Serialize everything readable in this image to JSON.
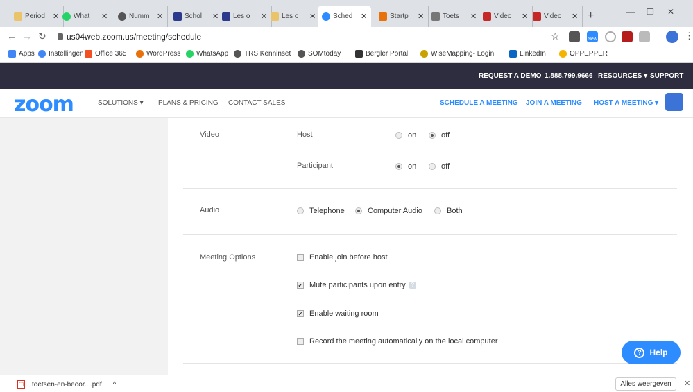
{
  "browser": {
    "tabs": [
      {
        "label": "Period",
        "color": "#e9c46a"
      },
      {
        "label": "What",
        "color": "#25d366"
      },
      {
        "label": "Numm",
        "color": "#555555"
      },
      {
        "label": "Schol",
        "color": "#2b3a8c"
      },
      {
        "label": "Les o",
        "color": "#2b3a8c"
      },
      {
        "label": "Les o",
        "color": "#e9c46a"
      },
      {
        "label": "Sched",
        "color": "#2d8cff"
      },
      {
        "label": "Startp",
        "color": "#e8710a"
      },
      {
        "label": "Toets",
        "color": "#777777"
      },
      {
        "label": "Video",
        "color": "#c62828"
      },
      {
        "label": "Video",
        "color": "#c62828"
      }
    ],
    "url": "us04web.zoom.us/meeting/schedule",
    "bookmarks": [
      {
        "label": "Apps",
        "icon": "apps-grid-icon",
        "color": "#4285f4"
      },
      {
        "label": "Instellingen",
        "icon": "gear-icon",
        "color": "#4285f4"
      },
      {
        "label": "Office 365",
        "icon": "office-icon",
        "color": "#f25022"
      },
      {
        "label": "WordPress",
        "icon": "wordpress-icon",
        "color": "#e8710a"
      },
      {
        "label": "WhatsApp",
        "icon": "whatsapp-icon",
        "color": "#25d366"
      },
      {
        "label": "TRS Kenninset",
        "icon": "globe-icon",
        "color": "#555555"
      },
      {
        "label": "SOMtoday",
        "icon": "globe-icon",
        "color": "#555555"
      },
      {
        "label": "Bergler Portal",
        "icon": "portal-icon",
        "color": "#333333"
      },
      {
        "label": "WiseMapping- Login",
        "icon": "wisemapping-icon",
        "color": "#c8a200"
      },
      {
        "label": "LinkedIn",
        "icon": "linkedin-icon",
        "color": "#0a66c2"
      },
      {
        "label": "OPPEPPER",
        "icon": "pepper-icon",
        "color": "#f4b400"
      }
    ],
    "ext_new_badge": "New"
  },
  "zoom": {
    "topbar": {
      "request_demo": "REQUEST A DEMO",
      "phone": "1.888.799.9666",
      "resources": "RESOURCES ▾",
      "support": "SUPPORT"
    },
    "nav": {
      "logo": "zoom",
      "solutions": "SOLUTIONS ▾",
      "plans": "PLANS & PRICING",
      "contact": "CONTACT SALES",
      "schedule": "SCHEDULE A MEETING",
      "join": "JOIN A MEETING",
      "host": "HOST A MEETING ▾"
    },
    "form": {
      "video_label": "Video",
      "host_label": "Host",
      "participant_label": "Participant",
      "on": "on",
      "off": "off",
      "audio_label": "Audio",
      "telephone": "Telephone",
      "computer_audio": "Computer Audio",
      "both": "Both",
      "meeting_options_label": "Meeting Options",
      "enable_join": "Enable join before host",
      "mute_entry": "Mute participants upon entry",
      "waiting_room": "Enable waiting room",
      "record_local": "Record the meeting automatically on the local computer"
    },
    "help": "Help"
  },
  "downloads": {
    "file": "toetsen-en-beoor....pdf",
    "show_all": "Alles weergeven"
  }
}
